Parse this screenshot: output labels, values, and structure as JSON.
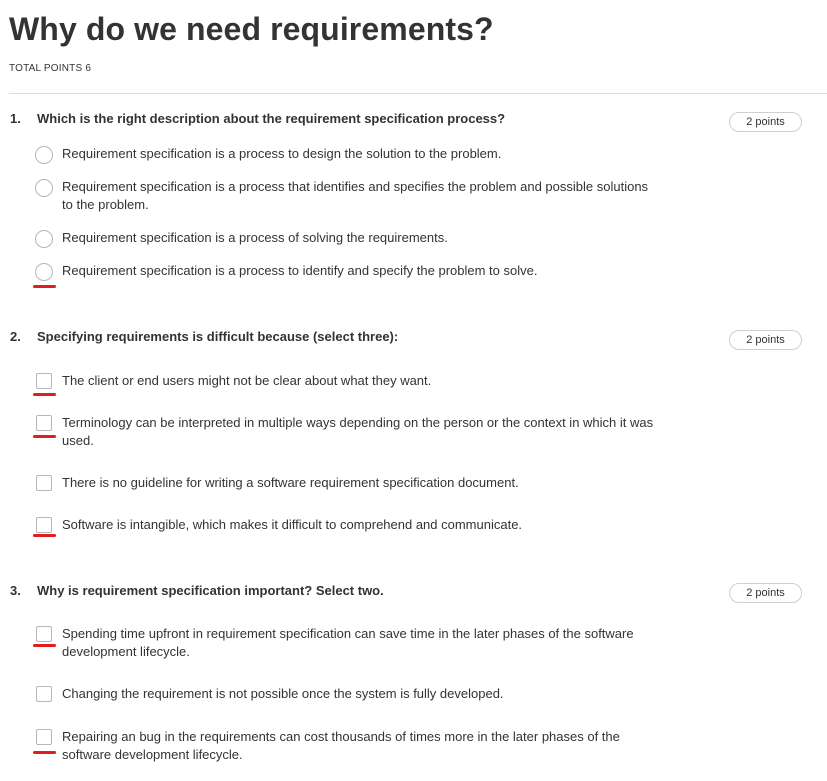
{
  "quiz": {
    "title": "Why do we need requirements?",
    "total_points": "TOTAL POINTS 6"
  },
  "questions": [
    {
      "number": "1.",
      "text": "Which is the right description about the requirement specification process?",
      "points": "2 points",
      "input_type": "radio",
      "options": [
        {
          "label": "Requirement specification is a process to design the solution to the problem.",
          "underlined": false
        },
        {
          "label": "Requirement specification is a process that identifies and specifies the problem and possible solutions to the problem.",
          "underlined": false
        },
        {
          "label": "Requirement specification is a process of solving the requirements.",
          "underlined": false
        },
        {
          "label": "Requirement specification is a process to identify and specify the problem to solve.",
          "underlined": true
        }
      ]
    },
    {
      "number": "2.",
      "text": "Specifying requirements is difficult because (select three):",
      "points": "2 points",
      "input_type": "checkbox",
      "options": [
        {
          "label": "The client or end users might not be clear about what they want.",
          "underlined": true
        },
        {
          "label": "Terminology can be interpreted in multiple ways depending on the person or the context in which it was used.",
          "underlined": true
        },
        {
          "label": "There is no guideline for writing a software requirement specification document.",
          "underlined": false
        },
        {
          "label": "Software is intangible, which makes it difficult to comprehend and communicate.",
          "underlined": true
        }
      ]
    },
    {
      "number": "3.",
      "text": "Why is requirement specification important? Select two.",
      "points": "2 points",
      "input_type": "checkbox",
      "options": [
        {
          "label": "Spending time upfront in requirement specification can save time in the later phases of the software development lifecycle.",
          "underlined": true
        },
        {
          "label": "Changing the requirement is not possible once the system is fully developed.",
          "underlined": false
        },
        {
          "label": "Repairing an bug in the requirements can cost thousands of times more in the later phases of the software development lifecycle.",
          "underlined": true
        }
      ]
    }
  ],
  "colors": {
    "annotation_underline": "#e01e1e",
    "control_border": "#b7b7b7",
    "text": "#333333"
  }
}
